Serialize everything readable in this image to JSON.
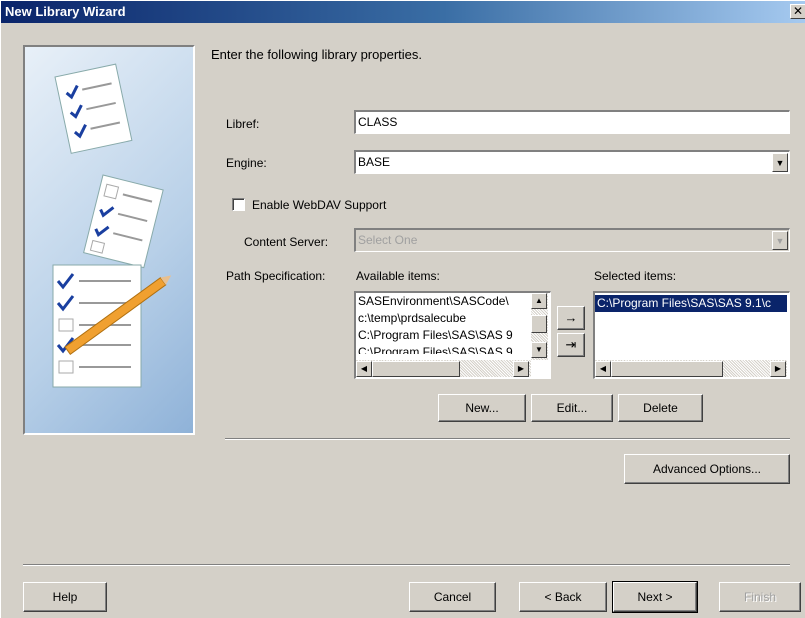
{
  "window": {
    "title": "New Library Wizard",
    "close_glyph": "✕"
  },
  "instruction": "Enter the following library properties.",
  "libref": {
    "label": "Libref:",
    "value": "CLASS"
  },
  "engine": {
    "label": "Engine:",
    "value": "BASE",
    "arrow": "▼"
  },
  "webdav": {
    "label": "Enable WebDAV Support",
    "checked": false
  },
  "content_server": {
    "label": "Content Server:",
    "value": "Select One",
    "arrow": "▼"
  },
  "path": {
    "label": "Path Specification:",
    "available_label": "Available items:",
    "selected_label": "Selected items:",
    "available_items": [
      "SASEnvironment\\SASCode\\",
      "c:\\temp\\prdsalecube",
      "C:\\Program Files\\SAS\\SAS 9",
      "C:\\Program Files\\SAS\\SAS 9"
    ],
    "selected_items": [
      "C:\\Program Files\\SAS\\SAS 9.1\\c"
    ],
    "add_glyph": "→",
    "add_all_glyph": "⇥",
    "scroll_up": "▲",
    "scroll_down": "▼",
    "scroll_left": "◀",
    "scroll_right": "▶"
  },
  "buttons": {
    "new": "New...",
    "edit": "Edit...",
    "delete": "Delete",
    "advanced": "Advanced Options...",
    "help": "Help",
    "cancel": "Cancel",
    "back": "< Back",
    "next": "Next >",
    "finish": "Finish"
  },
  "colors": {
    "title_start": "#0a246a",
    "title_end": "#a6caf0",
    "selection": "#0a246a",
    "dialog_bg": "#d4d0c8"
  },
  "illustration": {
    "icons": [
      "checklist-document-icon",
      "checklist-document-icon",
      "checklist-with-pencil-icon"
    ]
  }
}
